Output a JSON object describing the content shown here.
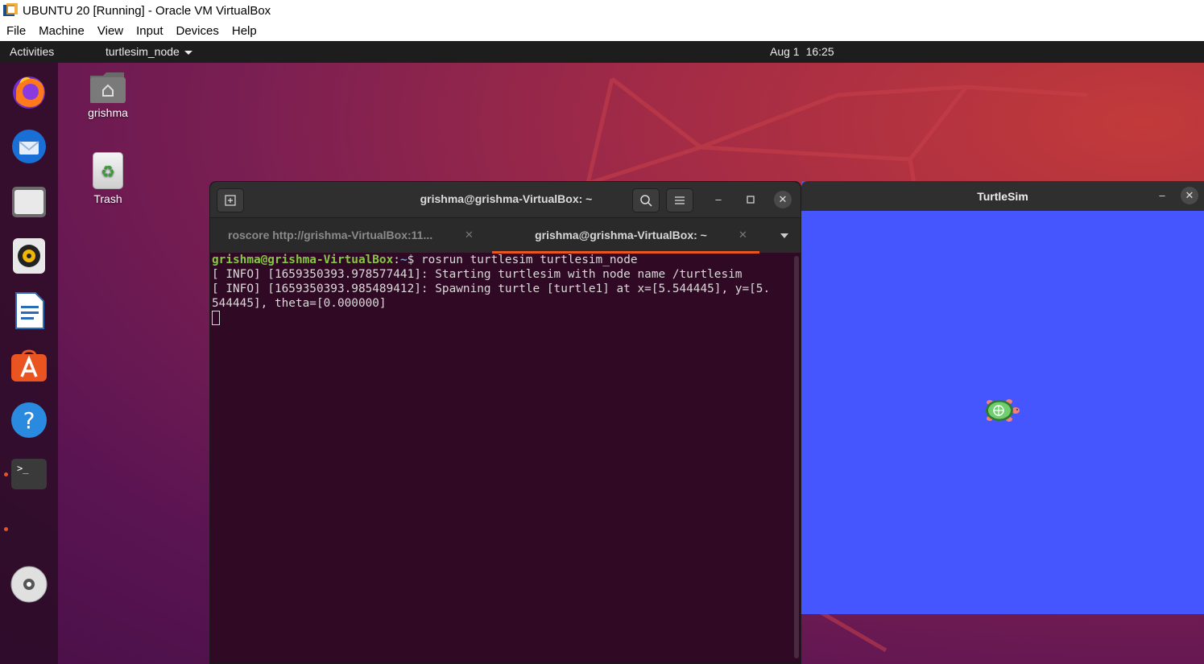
{
  "host": {
    "title": "UBUNTU 20 [Running] - Oracle VM VirtualBox",
    "menu": [
      "File",
      "Machine",
      "View",
      "Input",
      "Devices",
      "Help"
    ]
  },
  "topbar": {
    "activities": "Activities",
    "app_name": "turtlesim_node",
    "date": "Aug 1",
    "time": "16:25"
  },
  "dock": {
    "items": [
      "firefox-icon",
      "thunderbird-icon",
      "files-icon",
      "rhythmbox-icon",
      "libreoffice-writer-icon",
      "software-icon",
      "help-icon",
      "terminal-icon",
      "disc-icon"
    ]
  },
  "desktop": {
    "icons": [
      {
        "label": "grishma",
        "icon": "home-folder-icon"
      },
      {
        "label": "Trash",
        "icon": "trash-icon"
      }
    ]
  },
  "terminal": {
    "title": "grishma@grishma-VirtualBox: ~",
    "tabs": [
      {
        "label": "roscore http://grishma-VirtualBox:11...",
        "active": false
      },
      {
        "label": "grishma@grishma-VirtualBox: ~",
        "active": true
      }
    ],
    "prompt_user": "grishma@grishma-VirtualBox",
    "prompt_sep": ":",
    "prompt_path": "~",
    "prompt_end": "$ ",
    "command": "rosrun turtlesim turtlesim_node",
    "output": [
      "[ INFO] [1659350393.978577441]: Starting turtlesim with node name /turtlesim",
      "[ INFO] [1659350393.985489412]: Spawning turtle [turtle1] at x=[5.544445], y=[5.",
      "544445], theta=[0.000000]"
    ]
  },
  "turtlesim": {
    "title": "TurtleSim",
    "background": "#4556ff"
  },
  "colors": {
    "accent": "#e95420",
    "terminal_bg": "#300a24",
    "prompt_user": "#87c843",
    "prompt_path": "#729fcf"
  }
}
